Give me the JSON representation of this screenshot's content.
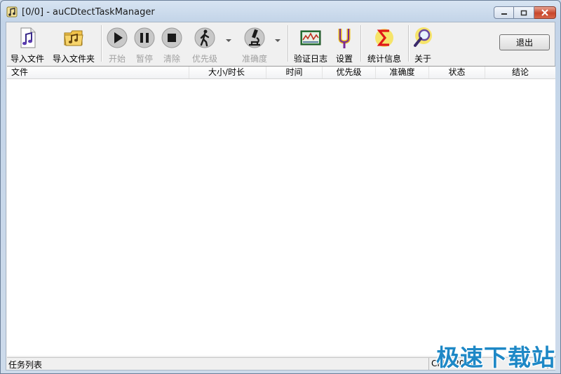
{
  "window": {
    "title": "[0/0] - auCDtectTaskManager",
    "controls": {
      "minimize": "minimize",
      "maximize": "maximize",
      "close": "close"
    }
  },
  "toolbar": {
    "import_file": "导入文件",
    "import_folder": "导入文件夹",
    "start": "开始",
    "pause": "暂停",
    "clear": "清除",
    "priority": "优先级",
    "accuracy": "准确度",
    "verify_log": "验证日志",
    "settings": "设置",
    "statistics": "统计信息",
    "about": "关于",
    "exit": "退出"
  },
  "table": {
    "columns": [
      "文件",
      "大小/时长",
      "时间",
      "优先级",
      "准确度",
      "状态",
      "结论"
    ],
    "rows": []
  },
  "status_bar": {
    "left": "任务列表",
    "cpu": "CPU: 20%"
  },
  "watermark": "极速下载站",
  "colors": {
    "accent_green": "#2a8a2a",
    "sigma_red": "#e01818",
    "watermark_blue": "#1e88c6"
  },
  "icons": {
    "import_file": "music-note-file-icon",
    "import_folder": "music-notes-folder-icon",
    "start": "play-icon",
    "pause": "pause-icon",
    "clear": "stop-icon",
    "priority": "walking-person-icon",
    "accuracy": "microscope-icon",
    "verify_log": "log-chart-icon",
    "settings": "tuning-fork-icon",
    "statistics": "sigma-icon",
    "about": "magnifier-icon"
  }
}
